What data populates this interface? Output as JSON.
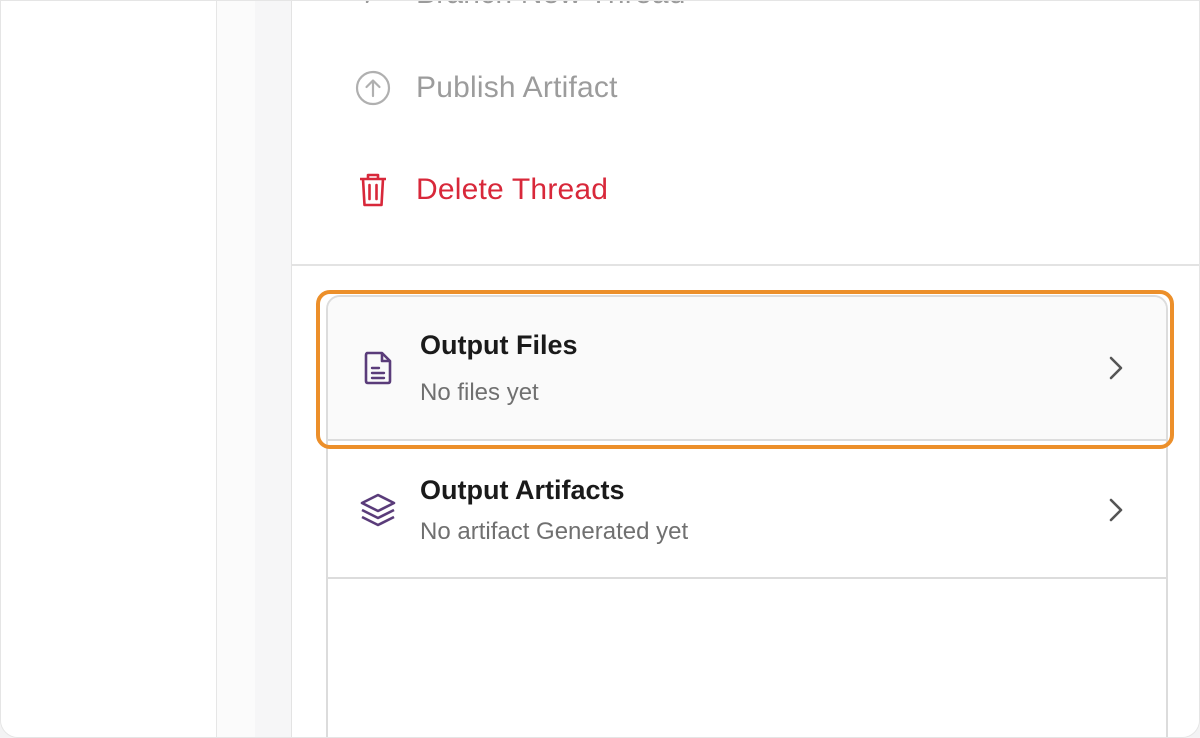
{
  "menu": {
    "branch_label": "Branch New Thread",
    "publish_label": "Publish Artifact",
    "delete_label": "Delete Thread"
  },
  "outputs": {
    "files": {
      "title": "Output Files",
      "subtitle": "No files yet",
      "icon": "document-icon"
    },
    "artifacts": {
      "title": "Output Artifacts",
      "subtitle": "No artifact Generated yet",
      "icon": "layers-icon"
    }
  },
  "colors": {
    "delete": "#d8283a",
    "muted": "#9c9c9c",
    "icon_purple": "#5a3c7a",
    "highlight": "#ec8f2a"
  }
}
